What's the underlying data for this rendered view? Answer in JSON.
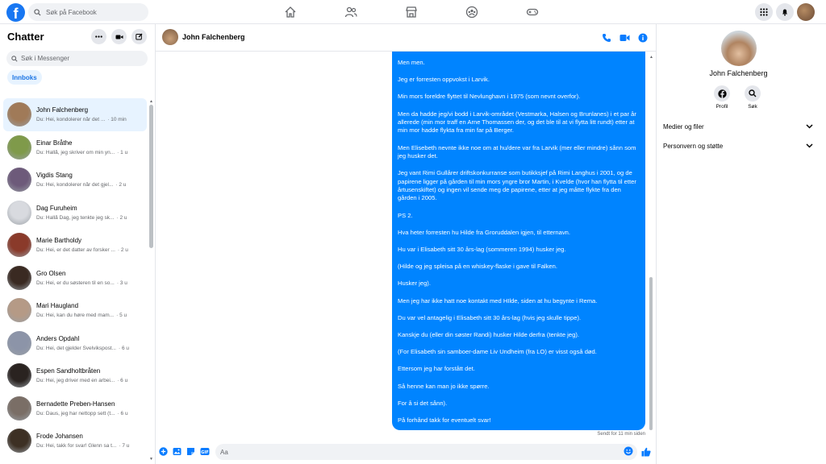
{
  "topbar": {
    "logo_letter": "f",
    "search_placeholder": "Søk på Facebook"
  },
  "left": {
    "title": "Chatter",
    "search_placeholder": "Søk i Messenger",
    "filter_chip": "Innboks",
    "conversations": [
      {
        "name": "John Falchenberg",
        "preview": "Du: Hei, kondolerer når det ...",
        "time": "· 10 min",
        "avatar": "#a07a58",
        "active": true
      },
      {
        "name": "Einar Bråthe",
        "preview": "Du: Hallå, jeg skriver om min yn...",
        "time": "· 1 u",
        "avatar": "#7f9a4a"
      },
      {
        "name": "Vigdis Stang",
        "preview": "Du: Hei, kondolerer når det gjel...",
        "time": "· 2 u",
        "avatar": "#6d5a7a"
      },
      {
        "name": "Dag Furuheim",
        "preview": "Du: Hallå Dag, jeg tenkte jeg sk...",
        "time": "· 2 u",
        "avatar": "#d8dadf"
      },
      {
        "name": "Marie Bartholdy",
        "preview": "Du: Hei, er det datter av forsker ...",
        "time": "· 2 u",
        "avatar": "#8a3a2a"
      },
      {
        "name": "Gro Olsen",
        "preview": "Du: Hei, er du søsteren til en so...",
        "time": "· 3 u",
        "avatar": "#3a2a22"
      },
      {
        "name": "Mari Haugland",
        "preview": "Du: Hei, kan du høre med mam...",
        "time": "· 5 u",
        "avatar": "#b59a86"
      },
      {
        "name": "Anders Opdahl",
        "preview": "Du: Hei, det gjelder Svelvikspost...",
        "time": "· 6 u",
        "avatar": "#8c94a8"
      },
      {
        "name": "Espen Sandholtbråten",
        "preview": "Du: Hei, jeg driver med en arbei...",
        "time": "· 6 u",
        "avatar": "#2a2320"
      },
      {
        "name": "Bernadette Preben-Hansen",
        "preview": "Du: Daus, jeg har nettopp sett (t...",
        "time": "· 6 u",
        "avatar": "#7a6e66"
      },
      {
        "name": "Frode Johansen",
        "preview": "Du: Hei, takk for svar! Glenn sa t...",
        "time": "· 7 u",
        "avatar": "#3d3024"
      }
    ]
  },
  "chat": {
    "contact_name": "John Falchenberg",
    "message_paragraphs": [
      "Men men.",
      "Jeg er forresten oppvokst i Larvik.",
      "Min mors foreldre flyttet til Nevlunghavn i 1975 (som nevnt overfor).",
      "Men da hadde jeg/vi bodd i Larvik-området (Vestmarka, Halsen og Brunlanes) i et par år allerede (min mor traff en Arne Thomassen der, og det ble til at vi flytta litt rundt) etter at min mor hadde flykta fra min far på Berger.",
      "Men Elisebeth nevnte ikke noe om at hu/dere var fra Larvik (mer eller mindre) sånn som jeg husker det.",
      "Jeg vant Rimi Gullårer driftskonkurranse som butikksjef på Rimi Langhus i 2001, og de papirene ligger på gården til min mors yngre bror Martin, i Kvelde (hvor han flytta til etter årtusenskiftet) og ingen vil sende meg de papirene, etter at jeg måtte flykte fra den gården i 2005.",
      "PS 2.",
      "Hva heter forresten hu Hilde fra Groruddalen igjen, til etternavn.",
      "Hu var i Elisabeth sitt 30 års-lag (sommeren 1994) husker jeg.",
      "(Hilde og jeg spleisa på en whiskey-flaske i gave til Falken.",
      "Husker jeg).",
      "Men jeg har ikke hatt noe kontakt med HIlde, siden at hu begynte i Rema.",
      "Du var vel antagelig i Elisabeth sitt 30 års-lag (hvis jeg skulle tippe).",
      "Kanskje du (eller din søster Randi) husker Hilde derfra (tenkte jeg).",
      "(For Elisabeth sin samboer-dame Liv Undheim (fra LO) er visst også død.",
      "Ettersom jeg har forstått det.",
      "Så henne kan man jo ikke spørre.",
      "For å si det sånn).",
      "På forhånd takk for eventuelt svar!"
    ],
    "sent_status": "Sendt for 11 min siden",
    "composer_placeholder": "Aa",
    "bubble_color": "#0084ff"
  },
  "right": {
    "name": "John Falchenberg",
    "profile_label": "Profil",
    "search_label": "Søk",
    "sections": [
      "Medier og filer",
      "Personvern og støtte"
    ]
  },
  "colors": {
    "accent": "#1877f2",
    "icon_blue": "#0a7cff"
  }
}
